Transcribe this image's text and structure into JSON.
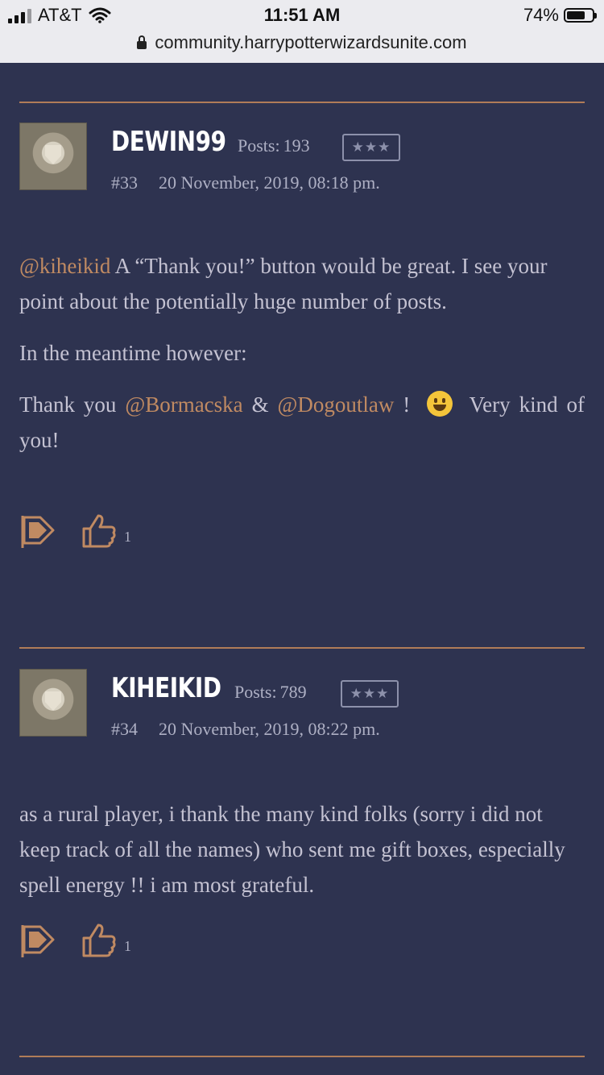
{
  "status_bar": {
    "carrier": "AT&T",
    "time": "11:51 AM",
    "battery": "74%",
    "battery_level": 0.74,
    "url": "community.harrypotterwizardsunite.com"
  },
  "posts": [
    {
      "username": "DEWIN99",
      "posts_label": "Posts:",
      "posts_count": "193",
      "rank": "★★★",
      "number": "#33",
      "date": "20 November, 2019, 08:18 pm.",
      "p1_mention": "@kiheikid",
      "p1_text": " A “Thank you!” button would be great. I see your point about the potentially huge number of posts.",
      "p2_text": "In the meantime however:",
      "p3_a": "Thank you ",
      "p3_mention1": "@Bormacska",
      "p3_b": " & ",
      "p3_mention2": "@Dogoutlaw",
      "p3_c": " !",
      "p3_d": "Very kind of you!",
      "likes": "1"
    },
    {
      "username": "KIHEIKID",
      "posts_label": "Posts:",
      "posts_count": "789",
      "rank": "★★★",
      "number": "#34",
      "date": "20 November, 2019, 08:22 pm.",
      "p1_text": "as a rural player, i thank the many kind folks (sorry i did not keep track of all the names) who sent me gift boxes, especially spell energy !! i am most grateful.",
      "likes": "1"
    }
  ],
  "colors": {
    "background": "#2e3350",
    "accent": "#c08a62",
    "divider": "#b07c58",
    "text": "#c4c2d2"
  }
}
